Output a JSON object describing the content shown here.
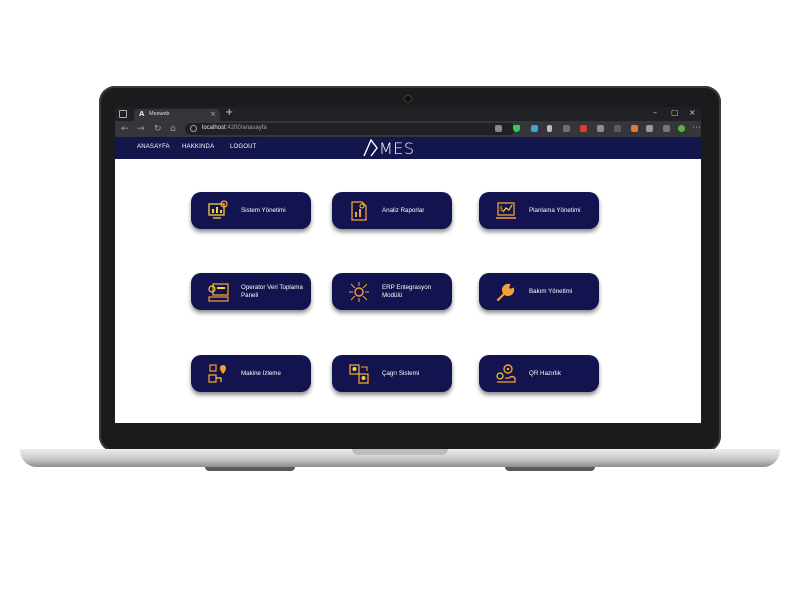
{
  "browser": {
    "tab_title": "Mesweb",
    "tab_favicon": "A",
    "url_host": "localhost",
    "url_path": ":4200/anasayfa"
  },
  "nav": {
    "links": [
      "ANASAYFA",
      "HAKKINDA",
      "LOGOUT"
    ],
    "logo_text": "MES"
  },
  "modules": [
    {
      "label": "Sistem Yönetimi",
      "icon": "monitor-gear-icon"
    },
    {
      "label": "Analiz Raporlar",
      "icon": "report-document-icon"
    },
    {
      "label": "Planlama Yönetimi",
      "icon": "dollar-chart-laptop-icon"
    },
    {
      "label": "Operator Veri Toplama Paneli",
      "icon": "operator-console-icon"
    },
    {
      "label": "ERP Entegrasyon Modülü",
      "icon": "network-gear-icon"
    },
    {
      "label": "Bakım Yönetimi",
      "icon": "wrench-icon"
    },
    {
      "label": "Makine Izleme",
      "icon": "machine-tracking-icon"
    },
    {
      "label": "Çagrı Sistemi",
      "icon": "call-system-icon"
    },
    {
      "label": "QR Hazırlık",
      "icon": "qr-gears-icon"
    }
  ],
  "colors": {
    "navbar": "#13154d",
    "card": "#12134f",
    "icon_orange": "#f5a033",
    "icon_yellow": "#f2d433"
  }
}
